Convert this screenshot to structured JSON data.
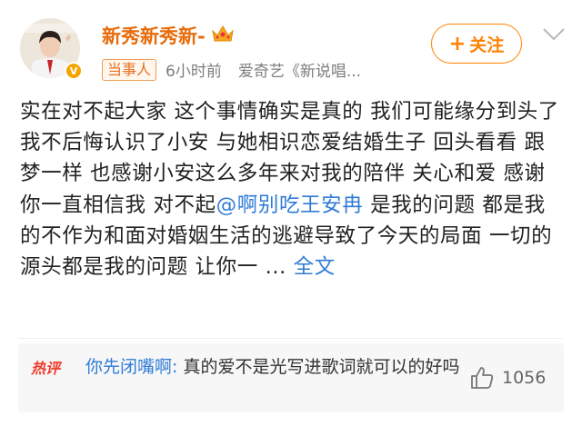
{
  "post": {
    "username": "新秀新秀新-",
    "crown_icon": "crown-icon",
    "verified_icon": "verified-v-icon",
    "tag": "当事人",
    "time": "6小时前",
    "source": "爱奇艺《新说唱...",
    "follow": {
      "plus": "+",
      "label": "关注"
    },
    "more_icon": "chevron-down-icon",
    "content": {
      "text_before": "实在对不起大家 这个事情确实是真的 我们可能缘分到头了 我不后悔认识了小安 与她相识恋爱结婚生子 回头看看 跟梦一样 也感谢小安这么多年来对我的陪伴 关心和爱 感谢你一直相信我 对不起",
      "mention": "@啊别吃王安冉",
      "text_after": " 是我的问题 都是我的不作为和面对婚姻生活的逃避导致了今天的局面 一切的源头都是我的问题 让你一 ... ",
      "full_text_link": "全文"
    }
  },
  "hot_comment": {
    "tag": "热评",
    "commenter": "你先闭嘴啊",
    "separator": ":",
    "text": " 真的爱不是光写进歌词就可以的好吗",
    "like_icon": "thumbs-up-icon",
    "likes": "1056"
  },
  "colors": {
    "username": "#e86b0a",
    "accent_orange": "#ff8200",
    "link_blue": "#2f7bd6",
    "hot_red": "#ef3b2c"
  }
}
